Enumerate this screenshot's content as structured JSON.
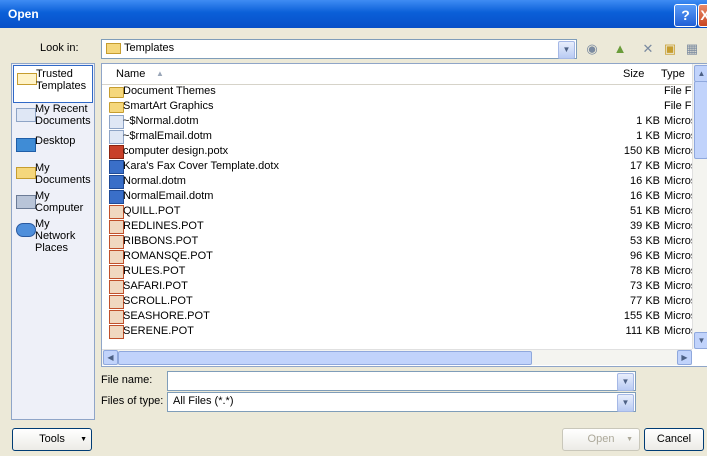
{
  "window": {
    "title": "Open",
    "help_glyph": "?",
    "close_glyph": "X"
  },
  "lookin": {
    "label": "Look in:",
    "value": "Templates",
    "dropdown_glyph": "▼"
  },
  "toolbar": {
    "back_glyph": "◉",
    "up_glyph": "▲",
    "delete_glyph": "✕",
    "new_folder_glyph": "▣",
    "views_glyph": "▦"
  },
  "places": [
    {
      "label": "Trusted Templates",
      "icon": "folder-icon"
    },
    {
      "label": "My Recent Documents",
      "icon": "recent-documents-icon"
    },
    {
      "label": "Desktop",
      "icon": "desktop-icon"
    },
    {
      "label": "My Documents",
      "icon": "my-documents-icon"
    },
    {
      "label": "My Computer",
      "icon": "my-computer-icon"
    },
    {
      "label": "My Network Places",
      "icon": "network-places-icon"
    }
  ],
  "columns": {
    "name": "Name",
    "size": "Size",
    "type": "Type",
    "sort_glyph": "▲"
  },
  "files": [
    {
      "name": "Document Themes",
      "size": "",
      "type": "File Fol",
      "icon": "folder"
    },
    {
      "name": "SmartArt Graphics",
      "size": "",
      "type": "File Fol",
      "icon": "folder"
    },
    {
      "name": "~$Normal.dotm",
      "size": "1 KB",
      "type": "Microso",
      "icon": "dotm"
    },
    {
      "name": "~$rmalEmail.dotm",
      "size": "1 KB",
      "type": "Microso",
      "icon": "dotm"
    },
    {
      "name": "computer design.potx",
      "size": "150 KB",
      "type": "Microso",
      "icon": "potx"
    },
    {
      "name": "Kara's Fax Cover Template.dotx",
      "size": "17 KB",
      "type": "Microso",
      "icon": "dotx"
    },
    {
      "name": "Normal.dotm",
      "size": "16 KB",
      "type": "Microso",
      "icon": "dotx"
    },
    {
      "name": "NormalEmail.dotm",
      "size": "16 KB",
      "type": "Microso",
      "icon": "dotx"
    },
    {
      "name": "QUILL.POT",
      "size": "51 KB",
      "type": "Microso",
      "icon": "pot"
    },
    {
      "name": "REDLINES.POT",
      "size": "39 KB",
      "type": "Microso",
      "icon": "pot"
    },
    {
      "name": "RIBBONS.POT",
      "size": "53 KB",
      "type": "Microso",
      "icon": "pot"
    },
    {
      "name": "ROMANSQE.POT",
      "size": "96 KB",
      "type": "Microso",
      "icon": "pot"
    },
    {
      "name": "RULES.POT",
      "size": "78 KB",
      "type": "Microso",
      "icon": "pot"
    },
    {
      "name": "SAFARI.POT",
      "size": "73 KB",
      "type": "Microso",
      "icon": "pot"
    },
    {
      "name": "SCROLL.POT",
      "size": "77 KB",
      "type": "Microso",
      "icon": "pot"
    },
    {
      "name": "SEASHORE.POT",
      "size": "155 KB",
      "type": "Microso",
      "icon": "pot"
    },
    {
      "name": "SERENE.POT",
      "size": "111 KB",
      "type": "Microso",
      "icon": "pot"
    }
  ],
  "scroll": {
    "up": "▲",
    "down": "▼",
    "left": "◀",
    "right": "▶"
  },
  "filename": {
    "label": "File name:",
    "value": ""
  },
  "filetype": {
    "label": "Files of type:",
    "value": "All Files (*.*)"
  },
  "buttons": {
    "tools": "Tools",
    "tools_arrow": "▼",
    "open": "Open",
    "open_arrow": "▼",
    "cancel": "Cancel"
  }
}
